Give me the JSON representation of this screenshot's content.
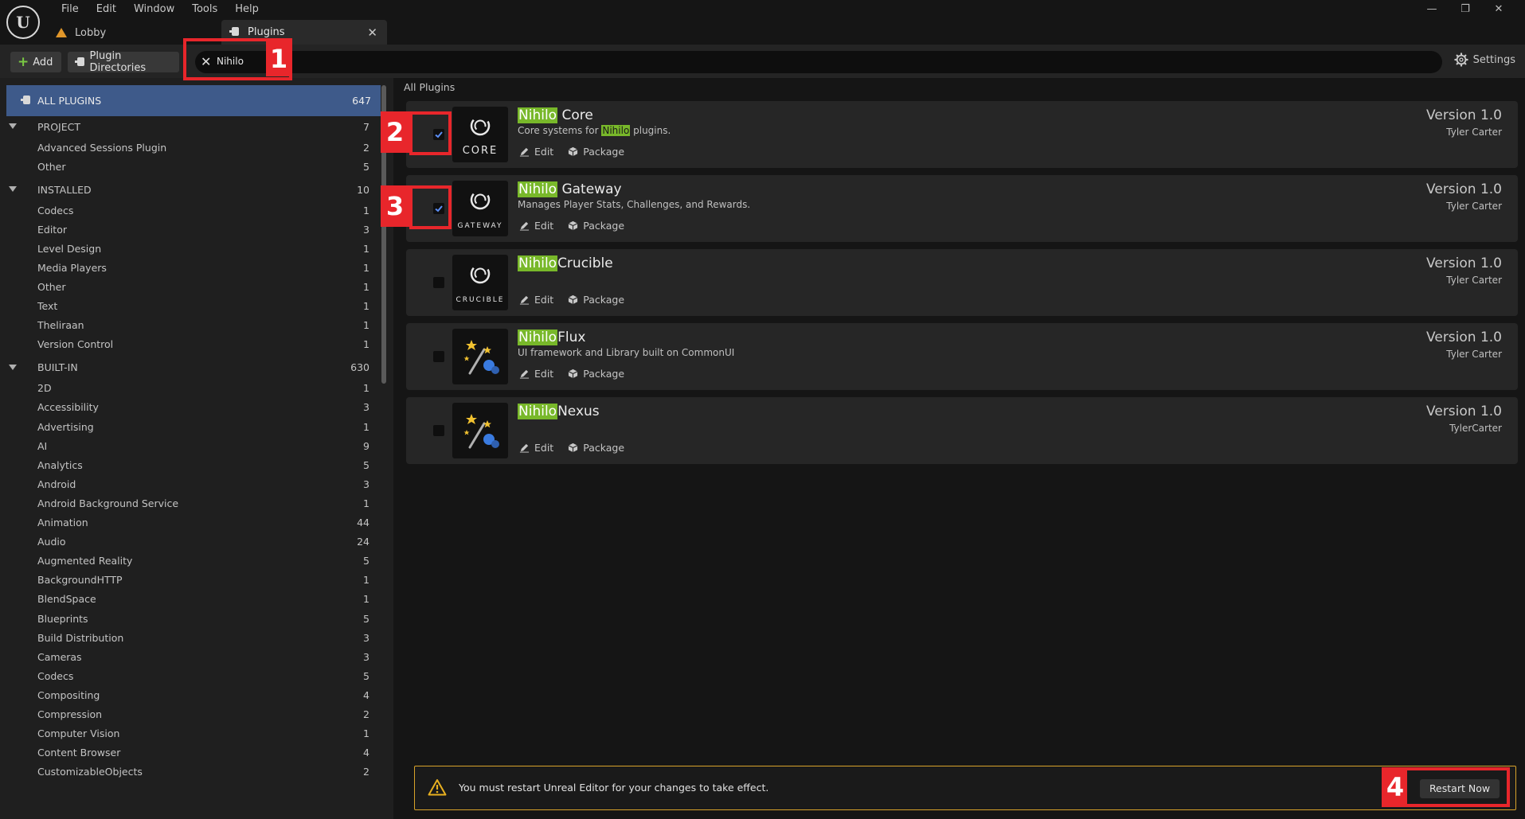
{
  "menubar": {
    "items": [
      "File",
      "Edit",
      "Window",
      "Tools",
      "Help"
    ]
  },
  "tabs": {
    "lobby": "Lobby",
    "plugins": "Plugins"
  },
  "toolbar": {
    "add_label": "Add",
    "plugin_dirs_label": "Plugin Directories",
    "search_value": "Nihilo",
    "settings_label": "Settings"
  },
  "annotations": [
    "1",
    "2",
    "3",
    "4"
  ],
  "sidebar": {
    "all_plugins": {
      "label": "ALL PLUGINS",
      "count": "647"
    },
    "rows": [
      {
        "type": "header",
        "label": "PROJECT",
        "count": "7"
      },
      {
        "type": "item",
        "label": "Advanced Sessions Plugin",
        "count": "2"
      },
      {
        "type": "item",
        "label": "Other",
        "count": "5"
      },
      {
        "type": "header",
        "label": "INSTALLED",
        "count": "10"
      },
      {
        "type": "item",
        "label": "Codecs",
        "count": "1"
      },
      {
        "type": "item",
        "label": "Editor",
        "count": "3"
      },
      {
        "type": "item",
        "label": "Level Design",
        "count": "1"
      },
      {
        "type": "item",
        "label": "Media Players",
        "count": "1"
      },
      {
        "type": "item",
        "label": "Other",
        "count": "1"
      },
      {
        "type": "item",
        "label": "Text",
        "count": "1"
      },
      {
        "type": "item",
        "label": "Theliraan",
        "count": "1"
      },
      {
        "type": "item",
        "label": "Version Control",
        "count": "1"
      },
      {
        "type": "header",
        "label": "BUILT-IN",
        "count": "630"
      },
      {
        "type": "item",
        "label": "2D",
        "count": "1"
      },
      {
        "type": "item",
        "label": "Accessibility",
        "count": "3"
      },
      {
        "type": "item",
        "label": "Advertising",
        "count": "1"
      },
      {
        "type": "item",
        "label": "AI",
        "count": "9"
      },
      {
        "type": "item",
        "label": "Analytics",
        "count": "5"
      },
      {
        "type": "item",
        "label": "Android",
        "count": "3"
      },
      {
        "type": "item",
        "label": "Android Background Service",
        "count": "1"
      },
      {
        "type": "item",
        "label": "Animation",
        "count": "44"
      },
      {
        "type": "item",
        "label": "Audio",
        "count": "24"
      },
      {
        "type": "item",
        "label": "Augmented Reality",
        "count": "5"
      },
      {
        "type": "item",
        "label": "BackgroundHTTP",
        "count": "1"
      },
      {
        "type": "item",
        "label": "BlendSpace",
        "count": "1"
      },
      {
        "type": "item",
        "label": "Blueprints",
        "count": "5"
      },
      {
        "type": "item",
        "label": "Build Distribution",
        "count": "3"
      },
      {
        "type": "item",
        "label": "Cameras",
        "count": "3"
      },
      {
        "type": "item",
        "label": "Codecs",
        "count": "5"
      },
      {
        "type": "item",
        "label": "Compositing",
        "count": "4"
      },
      {
        "type": "item",
        "label": "Compression",
        "count": "2"
      },
      {
        "type": "item",
        "label": "Computer Vision",
        "count": "1"
      },
      {
        "type": "item",
        "label": "Content Browser",
        "count": "4"
      },
      {
        "type": "item",
        "label": "CustomizableObjects",
        "count": "2"
      }
    ]
  },
  "main": {
    "title": "All Plugins",
    "plugins": [
      {
        "highlight": "Nihilo",
        "name_rest": " Core",
        "description": [
          "Core systems for ",
          "Nihilo",
          " plugins."
        ],
        "checked": true,
        "thumb": "ring",
        "thumb_label": "CORE",
        "edit": "Edit",
        "package": "Package",
        "version": "Version 1.0",
        "author": "Tyler Carter"
      },
      {
        "highlight": "Nihilo",
        "name_rest": " Gateway",
        "description": [
          "Manages Player Stats, Challenges, and Rewards.",
          "",
          ""
        ],
        "checked": true,
        "thumb": "ring",
        "thumb_label": "GATEWAY",
        "edit": "Edit",
        "package": "Package",
        "version": "Version 1.0",
        "author": "Tyler Carter"
      },
      {
        "highlight": "Nihilo",
        "name_rest": "Crucible",
        "description": [
          "",
          "",
          ""
        ],
        "checked": false,
        "thumb": "ring",
        "thumb_label": "CRUCIBLE",
        "edit": "Edit",
        "package": "Package",
        "version": "Version 1.0",
        "author": "Tyler Carter"
      },
      {
        "highlight": "Nihilo",
        "name_rest": "Flux",
        "description": [
          "UI framework and Library built on CommonUI",
          "",
          ""
        ],
        "checked": false,
        "thumb": "wand",
        "thumb_label": "",
        "edit": "Edit",
        "package": "Package",
        "version": "Version 1.0",
        "author": "Tyler Carter"
      },
      {
        "highlight": "Nihilo",
        "name_rest": "Nexus",
        "description": [
          "",
          "",
          ""
        ],
        "checked": false,
        "thumb": "wand",
        "thumb_label": "",
        "edit": "Edit",
        "package": "Package",
        "version": "Version 1.0",
        "author": "TylerCarter"
      }
    ]
  },
  "restart": {
    "message": "You must restart Unreal Editor for your changes to take effect.",
    "button": "Restart Now"
  },
  "colors": {
    "accent_selection": "#3e5a8a",
    "highlight": "#78b82a",
    "annotation": "#e8262b",
    "warning": "#d8a22a"
  }
}
